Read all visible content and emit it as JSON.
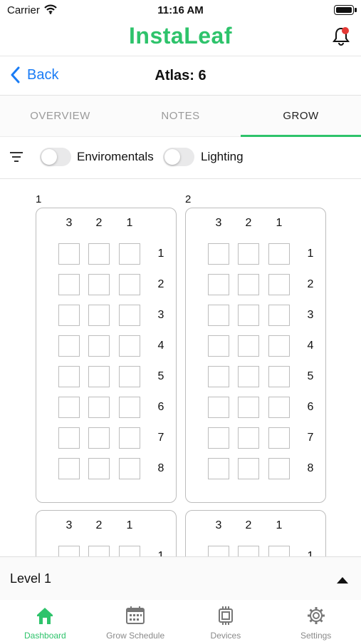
{
  "status_bar": {
    "carrier": "Carrier",
    "time": "11:16 AM"
  },
  "app": {
    "brand": "InstaLeaf",
    "notification_dot_color": "#e53935"
  },
  "navbar": {
    "back_label": "Back",
    "title": "Atlas: 6"
  },
  "tabs": [
    {
      "label": "OVERVIEW",
      "active": false
    },
    {
      "label": "NOTES",
      "active": false
    },
    {
      "label": "GROW",
      "active": true
    }
  ],
  "filters": {
    "toggles": [
      {
        "label": "Enviromentals",
        "on": false
      },
      {
        "label": "Lighting",
        "on": false
      }
    ]
  },
  "racks": [
    {
      "label": "1",
      "columns": [
        "3",
        "2",
        "1"
      ],
      "rows": [
        "1",
        "2",
        "3",
        "4",
        "5",
        "6",
        "7",
        "8"
      ]
    },
    {
      "label": "2",
      "columns": [
        "3",
        "2",
        "1"
      ],
      "rows": [
        "1",
        "2",
        "3",
        "4",
        "5",
        "6",
        "7",
        "8"
      ]
    },
    {
      "label": "",
      "columns": [
        "3",
        "2",
        "1"
      ],
      "rows": [
        "1"
      ]
    },
    {
      "label": "",
      "columns": [
        "3",
        "2",
        "1"
      ],
      "rows": [
        "1"
      ]
    }
  ],
  "level_selector": {
    "label": "Level 1"
  },
  "tab_bar": [
    {
      "label": "Dashboard",
      "icon": "home-icon",
      "active": true
    },
    {
      "label": "Grow Schedule",
      "icon": "calendar-icon",
      "active": false
    },
    {
      "label": "Devices",
      "icon": "chip-icon",
      "active": false
    },
    {
      "label": "Settings",
      "icon": "gear-icon",
      "active": false
    }
  ],
  "colors": {
    "accent": "#2ec36b",
    "link": "#1a7cf5"
  }
}
